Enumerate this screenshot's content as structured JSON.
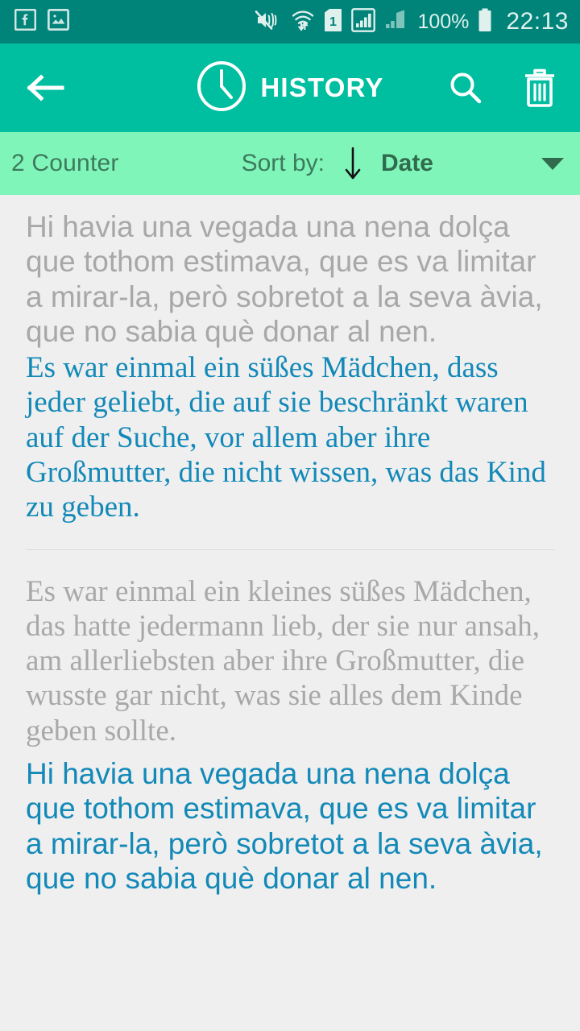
{
  "status_bar": {
    "background": "#00847a",
    "foreground": "#dff0ed",
    "icons": [
      "facebook-icon",
      "photo-icon",
      "vibrate-mute-icon",
      "wifi-transfer-icon",
      "sim-1-icon",
      "signal-bars-boxed-icon",
      "signal-bars-icon"
    ],
    "sim_badge": "1",
    "battery_percent": "100%",
    "time": "22:13"
  },
  "app_bar": {
    "background": "#00bfa0",
    "back_label": "Back",
    "title": "HISTORY",
    "clock_icon": "clock-icon",
    "search_label": "Search",
    "delete_label": "Delete all"
  },
  "sort_bar": {
    "background": "#80f5ba",
    "counter": "2 Counter",
    "sort_label": "Sort by:",
    "sort_direction": "descending",
    "sort_value": "Date",
    "caret": "dropdown-caret"
  },
  "colors": {
    "source_text": "#a8a8a8",
    "target_text": "#1389b8",
    "page_background": "#efefef",
    "divider": "#dcdcdc"
  },
  "history": {
    "items": [
      {
        "source_text": "Hi havia una vegada una nena dolça que tothom estimava, que es va limitar a mirar-la, però sobretot a la seva àvia, que no sabia què donar al nen.",
        "source_font": "sans",
        "target_text": "Es war einmal ein süßes Mädchen, dass jeder geliebt, die auf sie beschränkt waren auf der Suche, vor allem aber ihre Großmutter, die nicht wissen, was das Kind zu geben.",
        "target_font": "serif"
      },
      {
        "source_text": "Es war einmal ein kleines süßes Mädchen, das hatte jedermann lieb, der sie nur ansah, am allerliebsten aber ihre Großmutter, die wusste gar nicht, was sie alles dem Kinde geben sollte.",
        "source_font": "serif",
        "target_text": "Hi havia una vegada una nena dolça que tothom estimava, que es va limitar a mirar-la, però sobretot a la seva àvia, que no sabia què donar al nen.",
        "target_font": "sans"
      }
    ]
  }
}
